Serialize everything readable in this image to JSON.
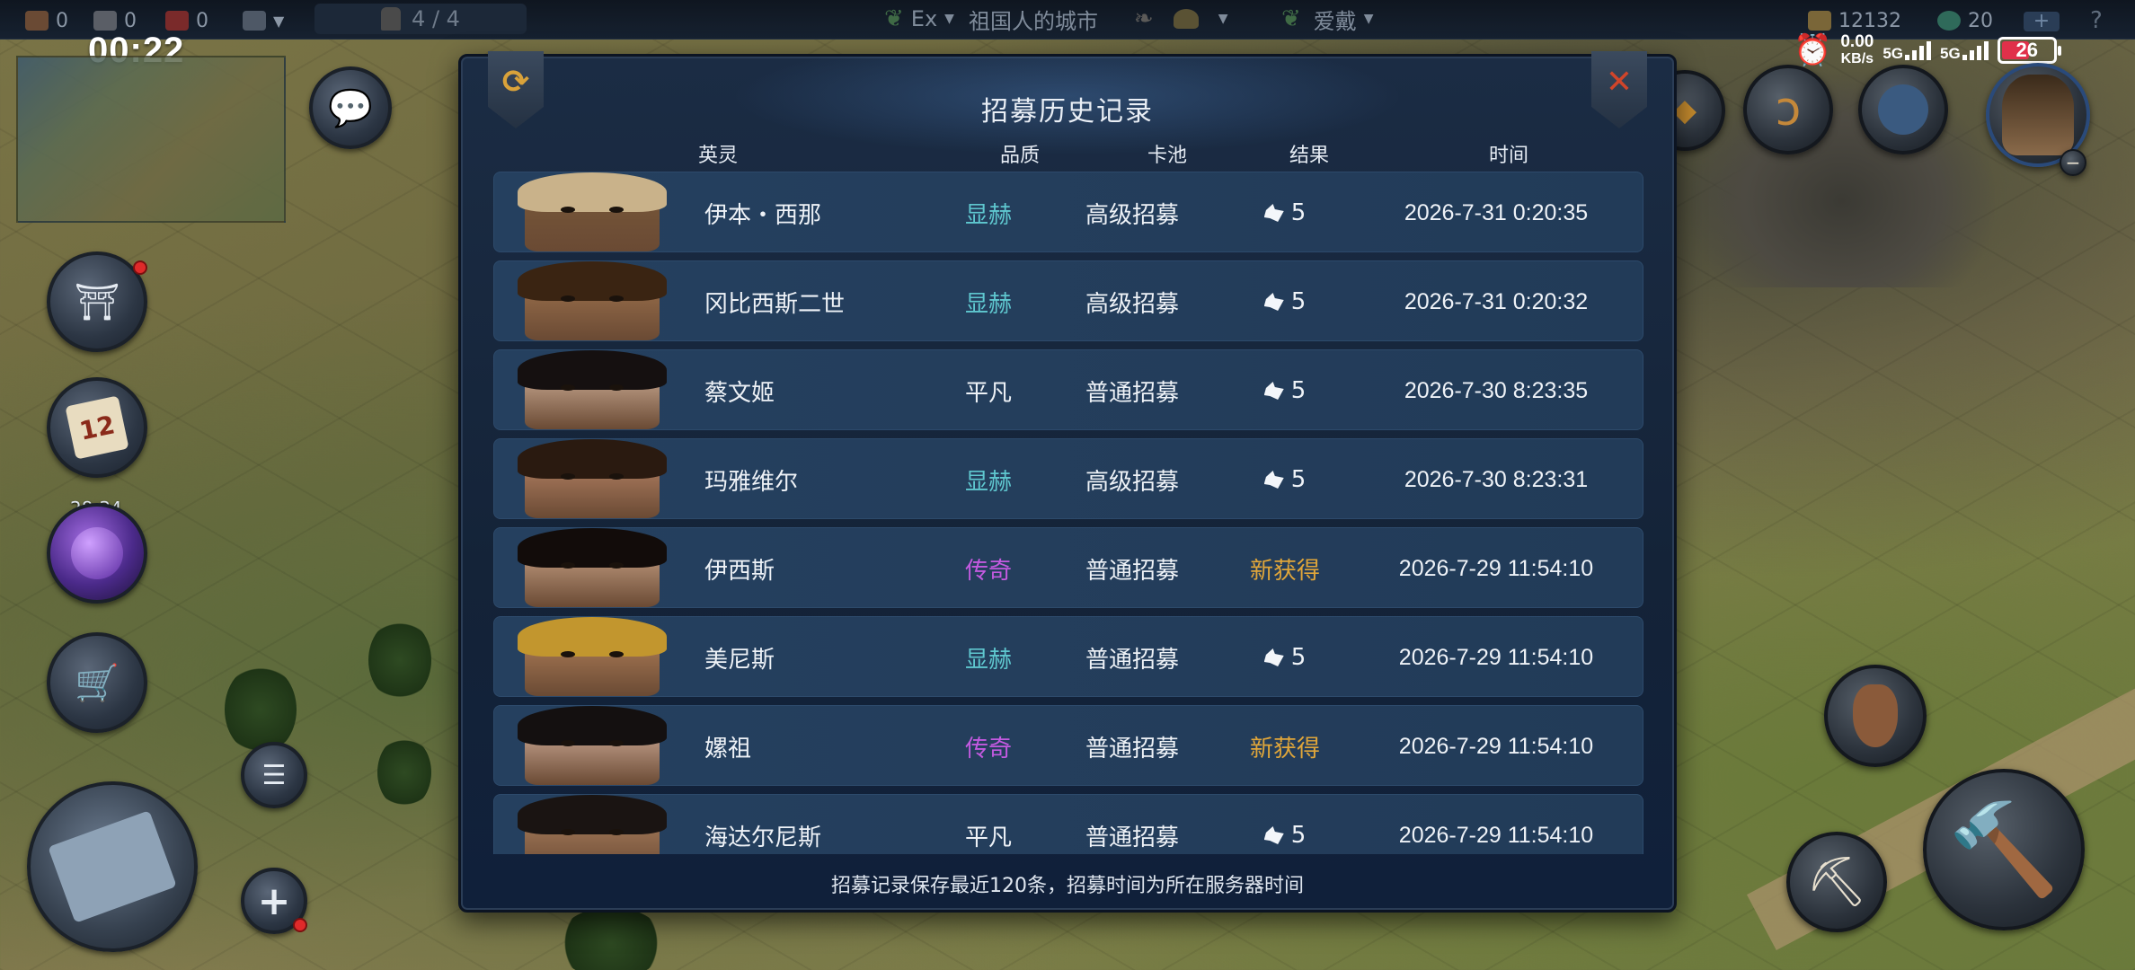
{
  "topbar": {
    "res1": "0",
    "res2": "0",
    "res3": "0",
    "army": "4 / 4",
    "server_tag": "Ex",
    "city_name": "祖国人的城市",
    "alliance": "爱戴",
    "gold": "12132",
    "gems": "20",
    "add": "+",
    "help": "?"
  },
  "status": {
    "time": "00:22",
    "speed_value": "0.00",
    "speed_unit": "KB/s",
    "net1": "5G",
    "net2": "5G",
    "battery": "26"
  },
  "hud": {
    "potion_timer": "28:34",
    "calendar_day": "12"
  },
  "modal": {
    "title": "招募历史记录",
    "headers": {
      "hero": "英灵",
      "quality": "品质",
      "pool": "卡池",
      "result": "结果",
      "time": "时间"
    },
    "footer": "招募记录保存最近120条，招募时间为所在服务器时间"
  },
  "records": [
    {
      "name": "伊本・西那",
      "quality": "显赫",
      "pool": "高级招募",
      "result": "5",
      "time": "2026-7-31  0:20:35"
    },
    {
      "name": "冈比西斯二世",
      "quality": "显赫",
      "pool": "高级招募",
      "result": "5",
      "time": "2026-7-31  0:20:32"
    },
    {
      "name": "蔡文姬",
      "quality": "平凡",
      "pool": "普通招募",
      "result": "5",
      "time": "2026-7-30  8:23:35"
    },
    {
      "name": "玛雅维尔",
      "quality": "显赫",
      "pool": "高级招募",
      "result": "5",
      "time": "2026-7-30  8:23:31"
    },
    {
      "name": "伊西斯",
      "quality": "传奇",
      "pool": "普通招募",
      "result": "新获得",
      "time": "2026-7-29  11:54:10"
    },
    {
      "name": "美尼斯",
      "quality": "显赫",
      "pool": "普通招募",
      "result": "5",
      "time": "2026-7-29  11:54:10"
    },
    {
      "name": "嫘祖",
      "quality": "传奇",
      "pool": "普通招募",
      "result": "新获得",
      "time": "2026-7-29  11:54:10"
    },
    {
      "name": "海达尔尼斯",
      "quality": "平凡",
      "pool": "普通招募",
      "result": "5",
      "time": "2026-7-29  11:54:10"
    }
  ],
  "colors": {
    "quality_prestige": "#5fc7cf",
    "quality_common": "#eef2f7",
    "quality_legend": "#c35ae0",
    "result_new": "#e0a63a",
    "modal_bg": "#162640",
    "row_bg": "#233d5b"
  },
  "icons": {
    "refresh": "refresh-icon",
    "close": "close-icon",
    "shard": "hero-shard-icon",
    "chat": "chat-icon",
    "layers": "layers-icon",
    "plus": "plus-icon",
    "map": "map-icon",
    "shovel": "shovel-icon",
    "hammer": "hammer-icon",
    "horn": "horn-icon",
    "alarm": "alarm-icon"
  }
}
